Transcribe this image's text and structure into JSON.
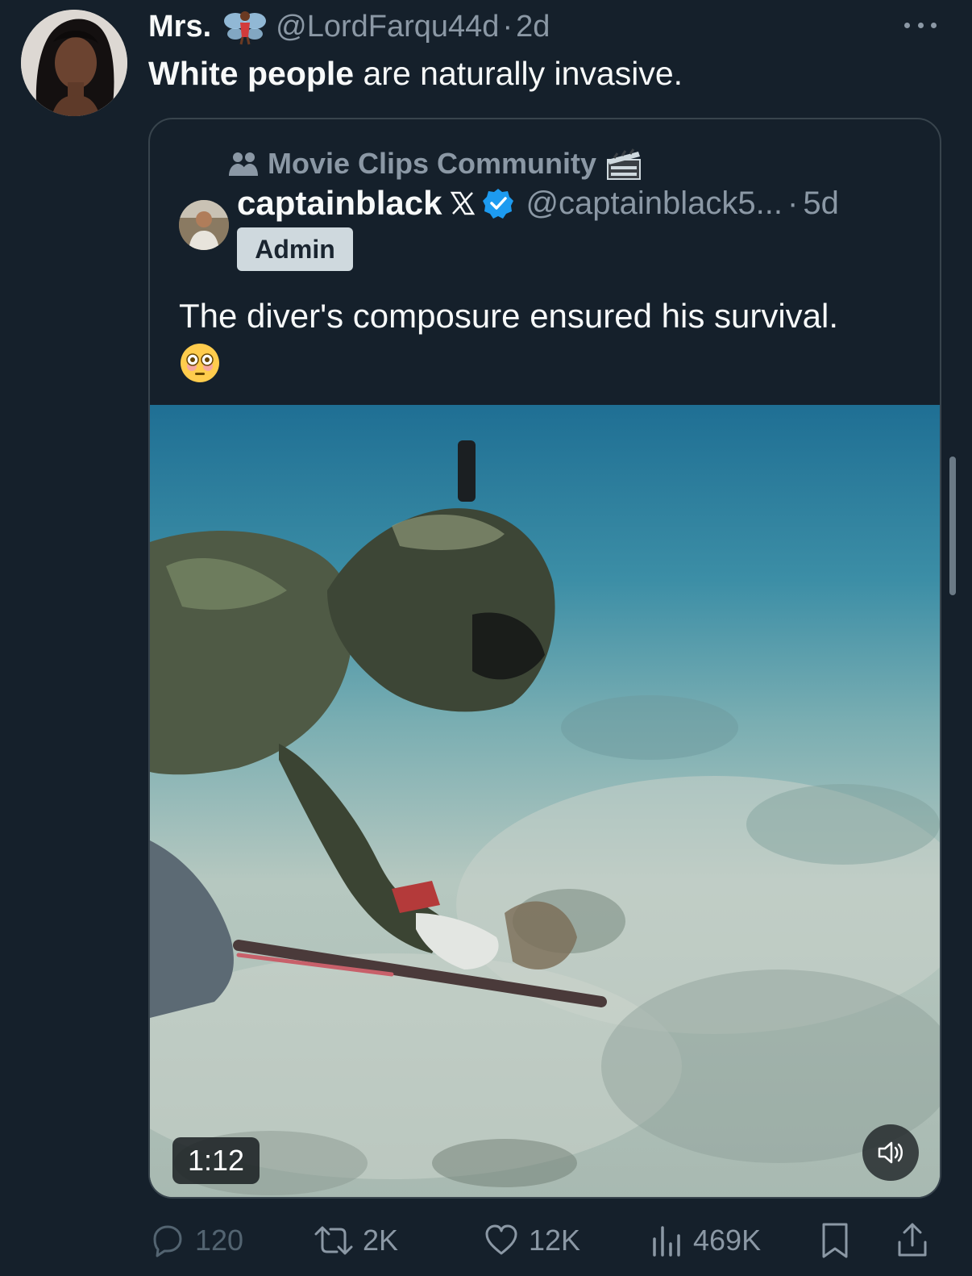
{
  "tweet": {
    "display_name": "Mrs.",
    "handle": "@LordFarqu44d",
    "separator": "·",
    "time": "2d",
    "text_bold": "White people",
    "text_rest": " are naturally invasive.",
    "avatar_icon": "profile-photo-woman",
    "name_emoji": "fairy-emoji"
  },
  "quote": {
    "community_name": "Movie Clips Community",
    "community_icon": "community-people-icon",
    "community_emoji": "clapper-board-emoji",
    "display_name": "captainblack",
    "affiliate_badge": "x-logo-badge",
    "verified": true,
    "handle": "@captainblack5...",
    "separator": "·",
    "time": "5d",
    "badge_label": "Admin",
    "text": "The diver's composure ensured his survival.",
    "trailing_emoji": "flushed-face-emoji",
    "video": {
      "duration": "1:12",
      "muted_icon": "speaker-icon"
    }
  },
  "actions": {
    "replies": "120",
    "reposts": "2K",
    "likes": "12K",
    "views": "469K"
  },
  "colors": {
    "background": "#15202b",
    "text_primary": "#f7f9f9",
    "text_secondary": "#8b98a5",
    "border": "#38444d",
    "verified_blue": "#1d9bf0"
  }
}
